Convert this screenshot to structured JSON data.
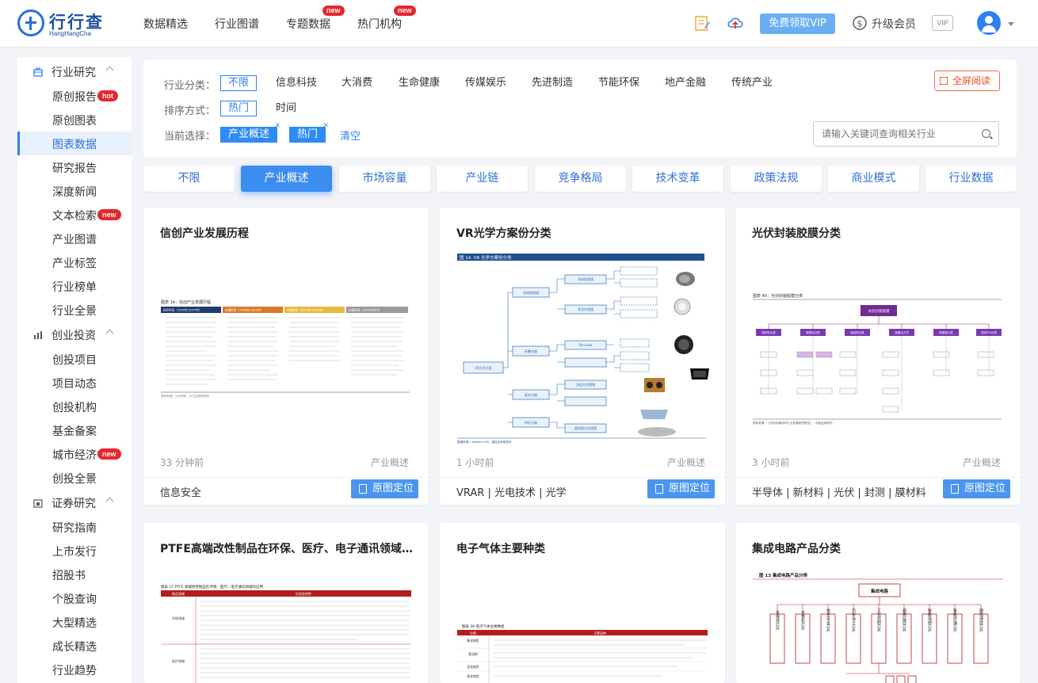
{
  "header": {
    "logo_text": "行行查",
    "logo_sub": "HangHangCha",
    "nav": [
      {
        "label": "数据精选",
        "badge": ""
      },
      {
        "label": "行业图谱",
        "badge": ""
      },
      {
        "label": "专题数据",
        "badge": "new"
      },
      {
        "label": "热门机构",
        "badge": "new"
      }
    ],
    "vip_button": "免费领取VIP",
    "upgrade": "升级会员",
    "vip_badge": "VIP"
  },
  "sidebar": {
    "groups": [
      {
        "label": "行业研究",
        "icon": "briefcase-icon",
        "items": [
          {
            "label": "原创报告",
            "badge": "hot",
            "active": false
          },
          {
            "label": "原创图表",
            "badge": "",
            "active": false
          },
          {
            "label": "图表数据",
            "badge": "",
            "active": true
          },
          {
            "label": "研究报告",
            "badge": "",
            "active": false
          },
          {
            "label": "深度新闻",
            "badge": "",
            "active": false
          },
          {
            "label": "文本检索",
            "badge": "new",
            "active": false
          },
          {
            "label": "产业图谱",
            "badge": "",
            "active": false
          },
          {
            "label": "产业标签",
            "badge": "",
            "active": false
          },
          {
            "label": "行业榜单",
            "badge": "",
            "active": false
          },
          {
            "label": "行业全景",
            "badge": "",
            "active": false
          }
        ]
      },
      {
        "label": "创业投资",
        "icon": "bar-chart-icon",
        "items": [
          {
            "label": "创投项目",
            "badge": "",
            "active": false
          },
          {
            "label": "项目动态",
            "badge": "",
            "active": false
          },
          {
            "label": "创投机构",
            "badge": "",
            "active": false
          },
          {
            "label": "基金备案",
            "badge": "",
            "active": false
          },
          {
            "label": "城市经济",
            "badge": "new",
            "active": false
          },
          {
            "label": "创投全景",
            "badge": "",
            "active": false
          }
        ]
      },
      {
        "label": "证券研究",
        "icon": "calendar-icon",
        "items": [
          {
            "label": "研究指南",
            "badge": "",
            "active": false
          },
          {
            "label": "上市发行",
            "badge": "",
            "active": false
          },
          {
            "label": "招股书",
            "badge": "",
            "active": false
          },
          {
            "label": "个股查询",
            "badge": "",
            "active": false
          },
          {
            "label": "大型精选",
            "badge": "",
            "active": false
          },
          {
            "label": "成长精选",
            "badge": "",
            "active": false
          },
          {
            "label": "行业趋势",
            "badge": "",
            "active": false
          }
        ]
      }
    ]
  },
  "filter": {
    "industry_label": "行业分类：",
    "industry_options": [
      "不限",
      "信息科技",
      "大消费",
      "生命健康",
      "传媒娱乐",
      "先进制造",
      "节能环保",
      "地产金融",
      "传统产业"
    ],
    "sort_label": "排序方式：",
    "sort_options": [
      "热门",
      "时间"
    ],
    "current_label": "当前选择：",
    "current_chips": [
      "产业概述",
      "热门"
    ],
    "clear": "清空",
    "fullscreen": "全屏阅读",
    "search_placeholder": "请输入关键词查询相关行业"
  },
  "tabs": [
    "不限",
    "产业概述",
    "市场容量",
    "产业链",
    "竞争格局",
    "技术变革",
    "政策法规",
    "商业模式",
    "行业数据"
  ],
  "locate_label": "原图定位",
  "cards": [
    {
      "title": "信创产业发展历程",
      "time": "33 分钟前",
      "category": "产业概述",
      "tags": "信息安全",
      "img": {
        "caption": "图表 14：信创产业发展历程",
        "headers": [
          "起步阶段（1999年-2007年）",
          "实践阶段（2008年-2013年）",
          "发展阶段（2014年-2019年）",
          "加速阶段（2020年至今）"
        ],
        "source": "资料来源：公开资料，东方证券研究所"
      }
    },
    {
      "title": "VR光学方案份分类",
      "time": "1 小时前",
      "category": "产业概述",
      "tags": "VRAR | 光电技术 | 光学",
      "img": {
        "caption": "图 14. VR 光学方案份分类",
        "root": "VR光学方案",
        "branches": [
          "非球面透镜",
          "折叠光路",
          "复合光路",
          "特定光路"
        ],
        "leaves": [
          "非球面透镜",
          "菲涅尔透镜",
          "Pancake",
          "多层光学透镜",
          "超短焦光学透镜"
        ],
        "source": "数据来源：wellsenn XR，国信证券研究所"
      }
    },
    {
      "title": "光伏封装胶膜分类",
      "time": "3 小时前",
      "category": "产业概述",
      "tags": "半导体 | 新材料 | 光伏 | 封测 | 膜材料",
      "img": {
        "caption": "图表 40：光伏封装胶膜分类",
        "root": "光伏封装胶膜",
        "branches": [
          "按材料分类",
          "按颜色分类",
          "按结构分类",
          "按固化方式",
          "按厚度分类",
          "按抗PID分类"
        ],
        "source": "资料来源：《光伏封装材料行业发展研究报告》，华鑫证券研究"
      }
    },
    {
      "title": "PTFE高端改性制品在环保、医疗、电子通讯领域的应用",
      "time": "",
      "category": "",
      "tags": "",
      "img": {
        "caption": "图表 15 PTFE 高端改性制品在环保、医疗、电子通讯领域的应用",
        "headers": [
          "制品领域",
          "应用及特性"
        ],
        "rows": [
          "环保领域",
          "医疗领域"
        ]
      }
    },
    {
      "title": "电子气体主要种类",
      "time": "",
      "category": "",
      "tags": "",
      "img": {
        "caption": "图表 39 电子气体主要种类",
        "headers": [
          "分类",
          "主要品种"
        ],
        "rows": [
          "氟化物类",
          "氢化物",
          "卤化物类",
          "碳化物类"
        ]
      }
    },
    {
      "title": "集成电路产品分类",
      "time": "",
      "category": "",
      "tags": "",
      "img": {
        "caption": "图 13 集成电路产品分类",
        "root": "集成电路",
        "branches": [
          "多媒体芯片",
          "计算机芯片",
          "信息安全芯片",
          "汽车电子芯片",
          "工业控制芯片",
          "视频监控芯片",
          "智能电网芯片",
          "智能终端芯片",
          "网络通信芯片"
        ]
      }
    }
  ],
  "colors": {
    "accent": "#2d7ff3",
    "badge": "#e8262d",
    "orange": "#ef4d22"
  }
}
